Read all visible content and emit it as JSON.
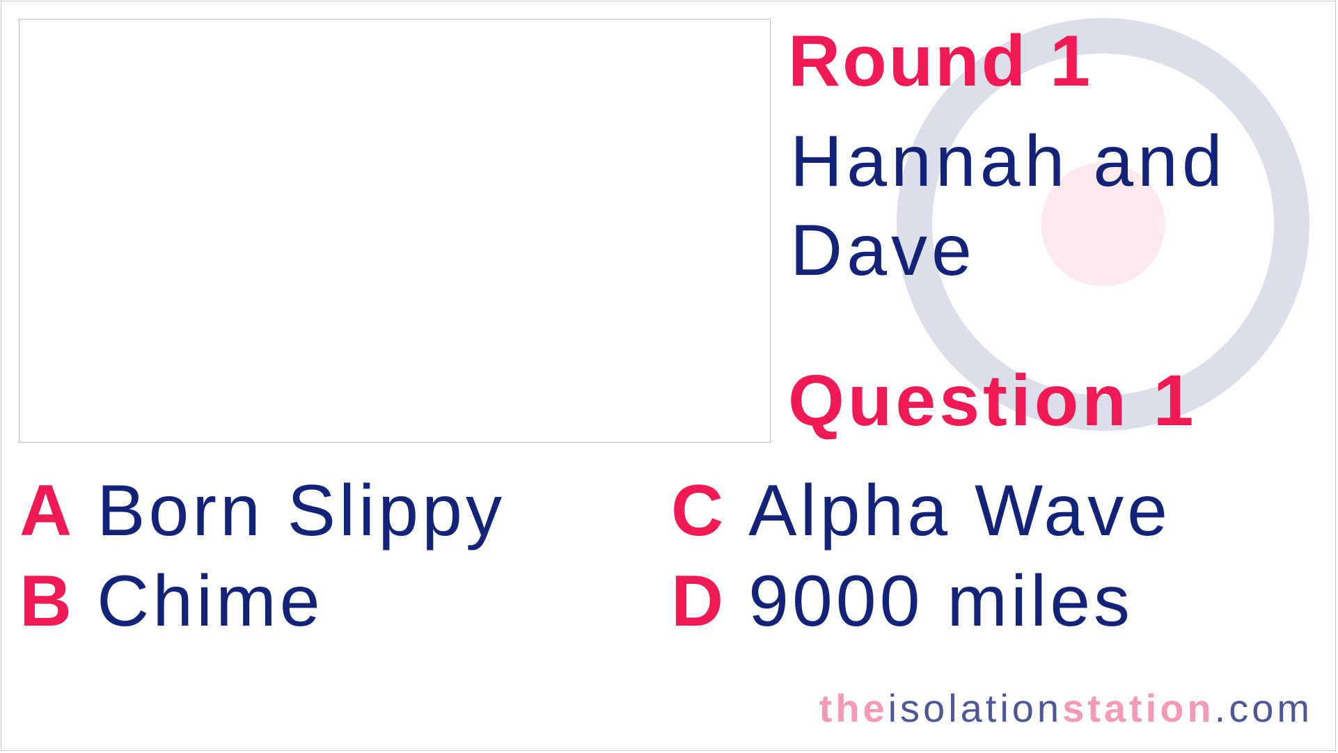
{
  "round": {
    "title": "Round 1"
  },
  "players": {
    "line1": "Hannah and",
    "line2": "Dave"
  },
  "question": {
    "title": "Question 1"
  },
  "answers": [
    {
      "letter": "A",
      "text": "Born Slippy"
    },
    {
      "letter": "B",
      "text": "Chime"
    },
    {
      "letter": "C",
      "text": "Alpha Wave"
    },
    {
      "letter": "D",
      "text": "9000 miles"
    }
  ],
  "footer": {
    "part1": "the",
    "part2": "isolation",
    "part3": "station",
    "part4": ".com"
  },
  "colors": {
    "accent": "#f21a55",
    "navy": "#13237a",
    "roundel_ring": "#dcdeea",
    "roundel_center": "#fde9ee",
    "footer_pink": "#f49ab6",
    "footer_navy": "#4c5698"
  },
  "icons": {
    "background": "roundel-icon"
  }
}
